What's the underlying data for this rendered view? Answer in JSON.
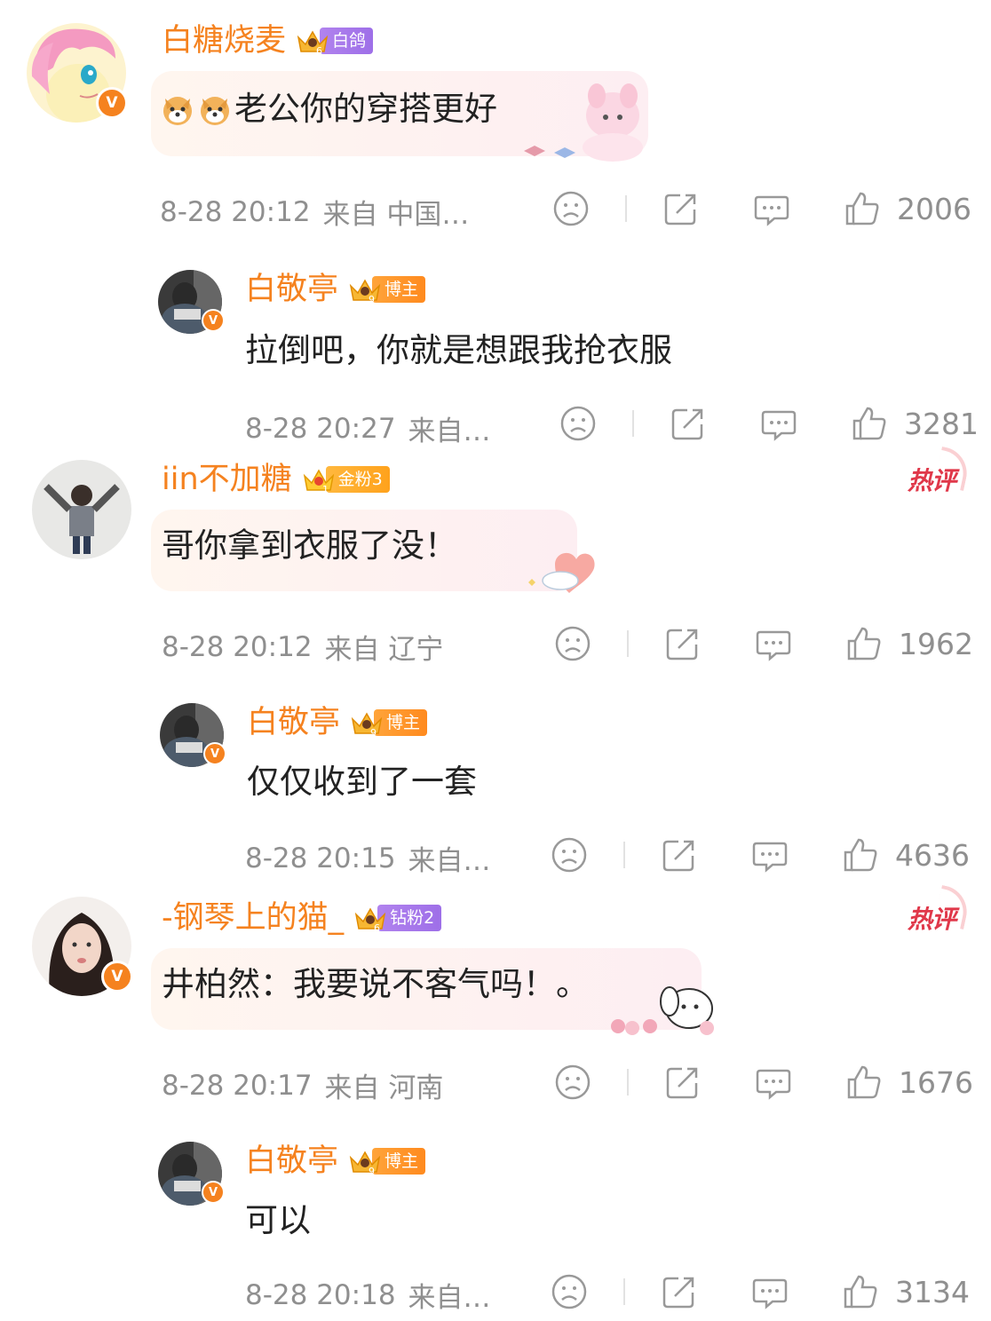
{
  "comments": [
    {
      "username": "白糖烧麦",
      "tag": "白鸽",
      "crown_level": "6",
      "text": "老公你的穿搭更好",
      "emoji": [
        "dog-face-emoji",
        "dog-face-emoji"
      ],
      "time": "8-28 20:12",
      "location": "来自 中国…",
      "likes": "2006",
      "hot": false,
      "replies": [
        {
          "username": "白敬亭",
          "tag": "博主",
          "crown_level": "9",
          "text": "拉倒吧，你就是想跟我抢衣服",
          "time": "8-28 20:27",
          "location": "来自…",
          "likes": "3281"
        }
      ]
    },
    {
      "username": "iin不加糖",
      "tag": "金粉3",
      "crown_level": "1",
      "text": "哥你拿到衣服了没！",
      "time": "8-28 20:12",
      "location": "来自 辽宁",
      "likes": "1962",
      "hot": true,
      "hot_label": "热评",
      "replies": [
        {
          "username": "白敬亭",
          "tag": "博主",
          "crown_level": "9",
          "text": "仅仅收到了一套",
          "time": "8-28 20:15",
          "location": "来自…",
          "likes": "4636"
        }
      ]
    },
    {
      "username": "-钢琴上的猫_",
      "tag": "钻粉2",
      "crown_level": "6",
      "text": "井柏然：我要说不客气吗！。",
      "time": "8-28 20:17",
      "location": "来自 河南",
      "likes": "1676",
      "hot": true,
      "hot_label": "热评",
      "replies": [
        {
          "username": "白敬亭",
          "tag": "博主",
          "crown_level": "9",
          "text": "可以",
          "time": "8-28 20:18",
          "location": "来自…",
          "likes": "3134"
        }
      ]
    }
  ],
  "verified_mark": "V",
  "colors": {
    "username": "#f5821f",
    "meta": "#8f8f8f",
    "hot": "#e0384a",
    "verified": "#f5821f"
  }
}
